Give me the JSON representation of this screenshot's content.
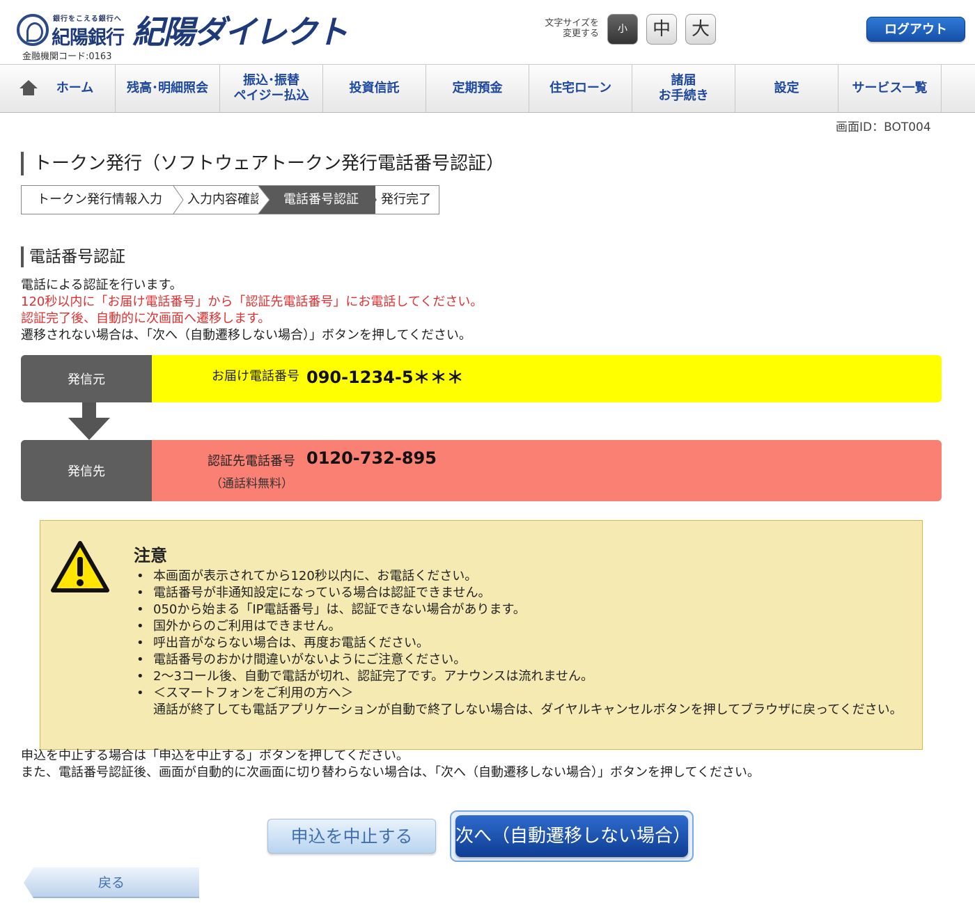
{
  "header": {
    "tagline": "銀行をこえる銀行へ",
    "bank_name": "紀陽銀行",
    "bank_code": "金融機関コード:0163",
    "brand": "紀陽ダイレクト",
    "font_size_label_1": "文字サイズを",
    "font_size_label_2": "変更する",
    "font_small": "小",
    "font_mid": "中",
    "font_big": "大",
    "logout": "ログアウト"
  },
  "nav": {
    "home": "ホーム",
    "balance": "残高･明細照会",
    "transfer_1": "振込･振替",
    "transfer_2": "ペイジー払込",
    "investment": "投資信託",
    "deposit": "定期預金",
    "loan": "住宅ローン",
    "procedures_1": "諸届",
    "procedures_2": "お手続き",
    "settings": "設定",
    "services": "サービス一覧"
  },
  "screen_id": "画面ID：BOT004",
  "page_title": "トークン発行（ソフトウェアトークン発行電話番号認証）",
  "steps": [
    "トークン発行情報入力",
    "入力内容確認",
    "電話番号認証",
    "発行完了"
  ],
  "section_title": "電話番号認証",
  "description": {
    "line1": "電話による認証を行います。",
    "line2": "120秒以内に「お届け電話番号」から「認証先電話番号」にお電話してください。",
    "line3": "認証完了後、自動的に次画面へ遷移します。",
    "line4": "遷移されない場合は、「次へ（自動遷移しない場合）」ボタンを押してください。"
  },
  "from_box": {
    "label": "発信元",
    "caption": "お届け電話番号",
    "number": "090-1234-5＊＊＊",
    "color": "#ffff00"
  },
  "to_box": {
    "label": "発信先",
    "caption": "認証先電話番号",
    "number": "0120-732-895",
    "note": "（通話料無料）",
    "color": "#f98073"
  },
  "caution": {
    "title": "注意",
    "items": [
      "本画面が表示されてから120秒以内に、お電話ください。",
      "電話番号が非通知設定になっている場合は認証できません。",
      "050から始まる「IP電話番号」は、認証できない場合があります。",
      "国外からのご利用はできません。",
      "呼出音がならない場合は、再度お電話ください。",
      "電話番号のおかけ間違いがないようにご注意ください。",
      "2～3コール後、自動で電話が切れ、認証完了です。アナウンスは流れません。",
      "＜スマートフォンをご利用の方へ＞",
      "通話が終了しても電話アプリケーションが自動で終了しない場合は、ダイヤルキャンセルボタンを押してブラウザに戻ってください。"
    ]
  },
  "bottom": {
    "line1": "申込を中止する場合は「申込を中止する」ボタンを押してください。",
    "line2": "また、電話番号認証後、画面が自動的に次画面に切り替わらない場合は、「次へ（自動遷移しない場合）」ボタンを押してください。"
  },
  "buttons": {
    "cancel": "申込を中止する",
    "next": "次へ（自動遷移しない場合）",
    "back": "戻る"
  },
  "icons": {
    "home": "home-icon",
    "warning": "warning-icon",
    "arrow": "arrow-down-icon"
  }
}
